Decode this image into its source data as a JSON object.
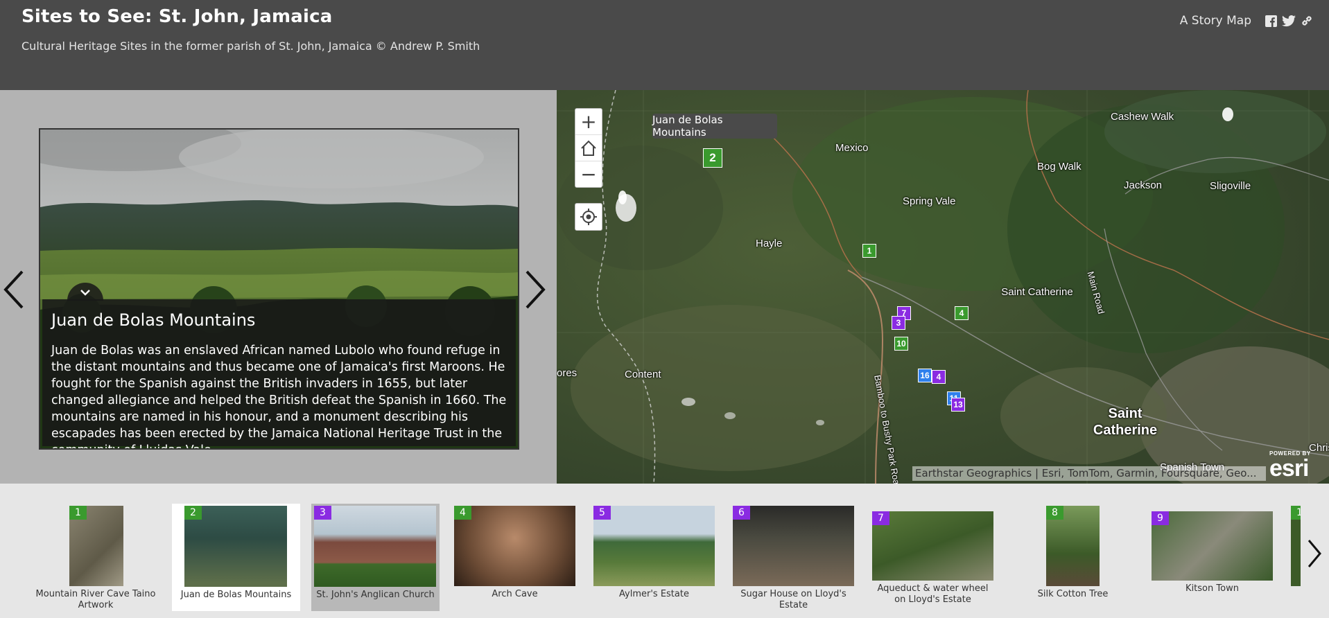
{
  "header": {
    "title": "Sites to See: St. John, Jamaica",
    "subtitle": "Cultural Heritage Sites in the former parish of St. John, Jamaica © Andrew P. Smith",
    "story_map_label": "A Story Map",
    "share_icons": [
      "facebook-icon",
      "twitter-icon",
      "link-icon"
    ]
  },
  "slide": {
    "title": "Juan de Bolas Mountains",
    "text": "Juan de Bolas was an enslaved African named Lubolo who found refuge in the distant mountains and thus became one of Jamaica's first Maroons. He fought for the Spanish against the British invaders in 1655, but later changed allegiance and helped the British defeat the Spanish in 1660. The mountains are named in his honour, and a monument describing his escapades has been erected by the Jamaica National Heritage Trust in the community of Lluidas Vale."
  },
  "map": {
    "tooltip": "Juan de Bolas Mountains",
    "zoom_buttons": [
      "+",
      "−"
    ],
    "places": [
      "Cashew Walk",
      "Mexico",
      "Bog Walk",
      "Jackson",
      "Sligoville",
      "Spring Vale",
      "Hayle",
      "Saint Catherine",
      "Main Road",
      "ores",
      "Content",
      "Bamboo to Bushy Park Road",
      "Saint Catherine",
      "Spanish Town",
      "Christ"
    ],
    "markers": [
      {
        "label": "2",
        "color": "#3a9a2e",
        "selected": true
      },
      {
        "label": "1",
        "color": "#3a9a2e"
      },
      {
        "label": "7",
        "color": "#8a2be2"
      },
      {
        "label": "3",
        "color": "#8a2be2"
      },
      {
        "label": "4",
        "color": "#3a9a2e"
      },
      {
        "label": "10",
        "color": "#3a9a2e"
      },
      {
        "label": "16",
        "color": "#2f80ed"
      },
      {
        "label": "4",
        "color": "#8a2be2"
      },
      {
        "label": "11",
        "color": "#2f80ed"
      },
      {
        "label": "13",
        "color": "#8a2be2"
      }
    ],
    "attribution": "Earthstar Geographics | Esri, TomTom, Garmin, Foursquare, Geo...",
    "powered_by": "POWERED BY",
    "esri_logo": "esri"
  },
  "carousel": {
    "items": [
      {
        "num": "1",
        "label": "Mountain River Cave Taino Artwork",
        "color": "#3a9a2e"
      },
      {
        "num": "2",
        "label": "Juan de Bolas Mountains",
        "color": "#3a9a2e"
      },
      {
        "num": "3",
        "label": "St. John's Anglican Church",
        "color": "#8a2be2"
      },
      {
        "num": "4",
        "label": "Arch Cave",
        "color": "#3a9a2e"
      },
      {
        "num": "5",
        "label": "Aylmer's Estate",
        "color": "#8a2be2"
      },
      {
        "num": "6",
        "label": "Sugar House on Lloyd's Estate",
        "color": "#8a2be2"
      },
      {
        "num": "7",
        "label": "Aqueduct & water wheel on Lloyd's Estate",
        "color": "#8a2be2"
      },
      {
        "num": "8",
        "label": "Silk Cotton Tree",
        "color": "#3a9a2e"
      },
      {
        "num": "9",
        "label": "Kitson Town",
        "color": "#8a2be2"
      },
      {
        "num": "1",
        "label": "",
        "color": "#3a9a2e"
      }
    ]
  }
}
